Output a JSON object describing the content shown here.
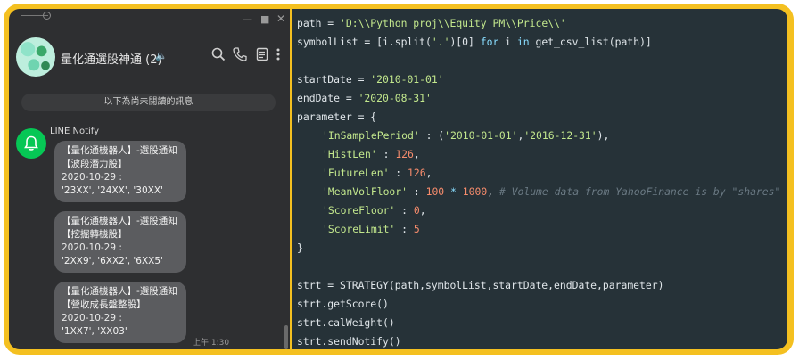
{
  "colors": {
    "frame": "#f4c020",
    "chat_bg": "#2e2f31",
    "bubble": "#5b5c5f",
    "line_green": "#06c755",
    "editor_bg": "#263238"
  },
  "window_controls": {
    "minimize": "—",
    "maximize": "■",
    "close": "✕"
  },
  "chat": {
    "title": "量化通選股神通 (2)",
    "mute_icon": "speaker-muted-icon",
    "header_icons": [
      "search-icon",
      "phone-icon",
      "notes-icon",
      "more-icon"
    ],
    "unread_banner": "以下為尚未閱讀的訊息",
    "sender": "LINE Notify",
    "messages": [
      {
        "line1": "【量化通機器人】-選股通知",
        "line2": "【波段潛力股】",
        "date": "2020-10-29 :",
        "codes": "'23XX', '24XX', '30XX'"
      },
      {
        "line1": "【量化通機器人】-選股通知",
        "line2": "【挖掘轉機股】",
        "date": "2020-10-29 :",
        "codes": "'2XX9', '6XX2', '6XX5'"
      },
      {
        "line1": "【量化通機器人】-選股通知",
        "line2": "【營收成長盤整股】",
        "date": "2020-10-29 :",
        "codes": "'1XX7', 'XX03'"
      }
    ],
    "time": "上午 1:30"
  },
  "code": {
    "l1": {
      "a": "path = ",
      "b": "'D:\\\\Python_proj\\\\Equity PM\\\\Price\\\\'"
    },
    "l2": {
      "a": "symbolList = [i.split(",
      "b": "'.'",
      "c": ")[0] ",
      "d": "for",
      "e": " i ",
      "f": "in",
      "g": " get_csv_list(path)]"
    },
    "l3": {
      "a": "startDate = ",
      "b": "'2010-01-01'"
    },
    "l4": {
      "a": "endDate = ",
      "b": "'2020-08-31'"
    },
    "l5": {
      "a": "parameter = {"
    },
    "l6": {
      "a": "'InSamplePeriod'",
      "b": " : (",
      "c": "'2010-01-01'",
      "d": ",",
      "e": "'2016-12-31'",
      "f": "),"
    },
    "l7": {
      "a": "'HistLen'",
      "b": " : ",
      "c": "126",
      "d": ","
    },
    "l8": {
      "a": "'FutureLen'",
      "b": " : ",
      "c": "126",
      "d": ","
    },
    "l9": {
      "a": "'MeanVolFloor'",
      "b": " : ",
      "c": "100",
      "d": " * ",
      "e": "1000",
      "f": ", ",
      "g": "# Volume data from YahooFinance is by \"shares\""
    },
    "l10": {
      "a": "'ScoreFloor'",
      "b": " : ",
      "c": "0",
      "d": ","
    },
    "l11": {
      "a": "'ScoreLimit'",
      "b": " : ",
      "c": "5"
    },
    "l12": {
      "a": "}"
    },
    "l13": {
      "a": "strt = STRATEGY(path,symbolList,startDate,endDate,parameter)"
    },
    "l14": {
      "a": "strt.getScore()"
    },
    "l15": {
      "a": "strt.calWeight()"
    },
    "l16": {
      "a": "strt.sendNotify()"
    }
  }
}
